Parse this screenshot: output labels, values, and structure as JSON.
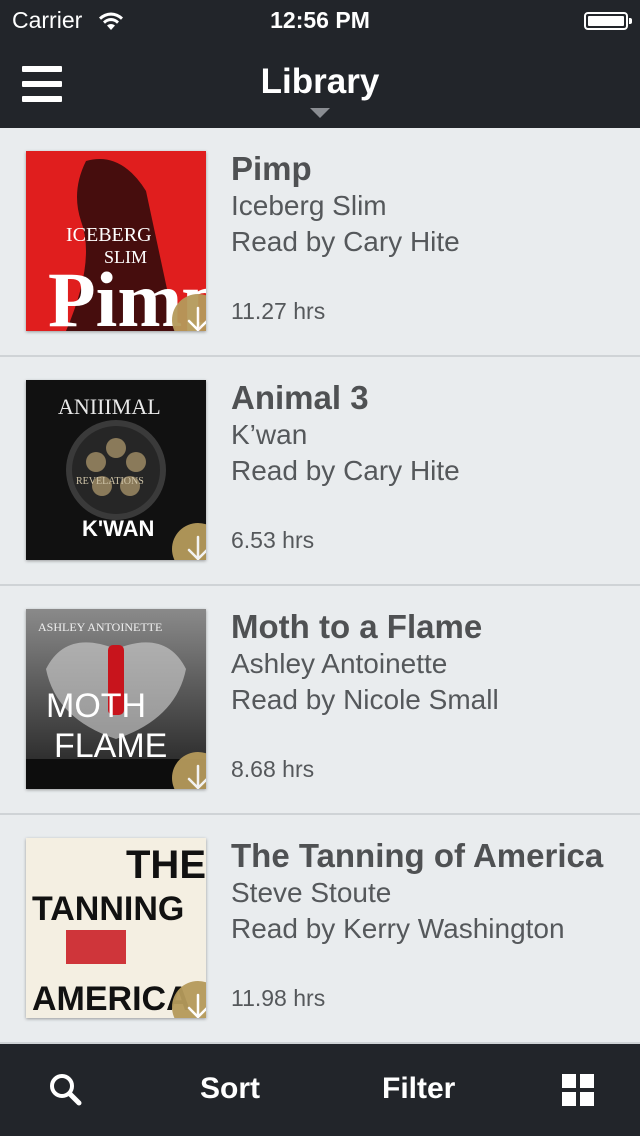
{
  "status_bar": {
    "carrier": "Carrier",
    "time": "12:56 PM"
  },
  "header": {
    "title": "Library"
  },
  "books": [
    {
      "title": "Pimp",
      "author": "Iceberg Slim",
      "reader": "Read by Cary Hite",
      "duration": "11.27 hrs",
      "cover_text_top": "ICEBERG",
      "cover_text_mid": "SLIM",
      "cover_text_big": "Pimp",
      "cover_color": "#e01e1e"
    },
    {
      "title": "Animal 3",
      "author": "K’wan",
      "reader": "Read by Cary Hite",
      "duration": "6.53 hrs",
      "cover_text_top": "ANIIIMAL",
      "cover_text_mid": "REVELATIONS",
      "cover_text_big": "K'WAN",
      "cover_color": "#111111"
    },
    {
      "title": "Moth to a Flame",
      "author": "Ashley Antoinette",
      "reader": "Read by Nicole Small",
      "duration": "8.68 hrs",
      "cover_text_top": "ASHLEY ANTOINETTE",
      "cover_text_mid": "MOTH",
      "cover_text_big": "FLAME",
      "cover_color": "#6e6e6e"
    },
    {
      "title": "The Tanning of America",
      "author": "Steve Stoute",
      "reader": "Read by Kerry Washington",
      "duration": "11.98 hrs",
      "cover_text_top": "THE",
      "cover_text_mid": "TANNING",
      "cover_text_big": "AMERICA",
      "cover_color": "#f4efe2"
    }
  ],
  "tabbar": {
    "sort_label": "Sort",
    "filter_label": "Filter"
  },
  "colors": {
    "header_bg": "#22252a",
    "list_bg": "#e9ecee",
    "download_accent": "#b59a5b"
  }
}
